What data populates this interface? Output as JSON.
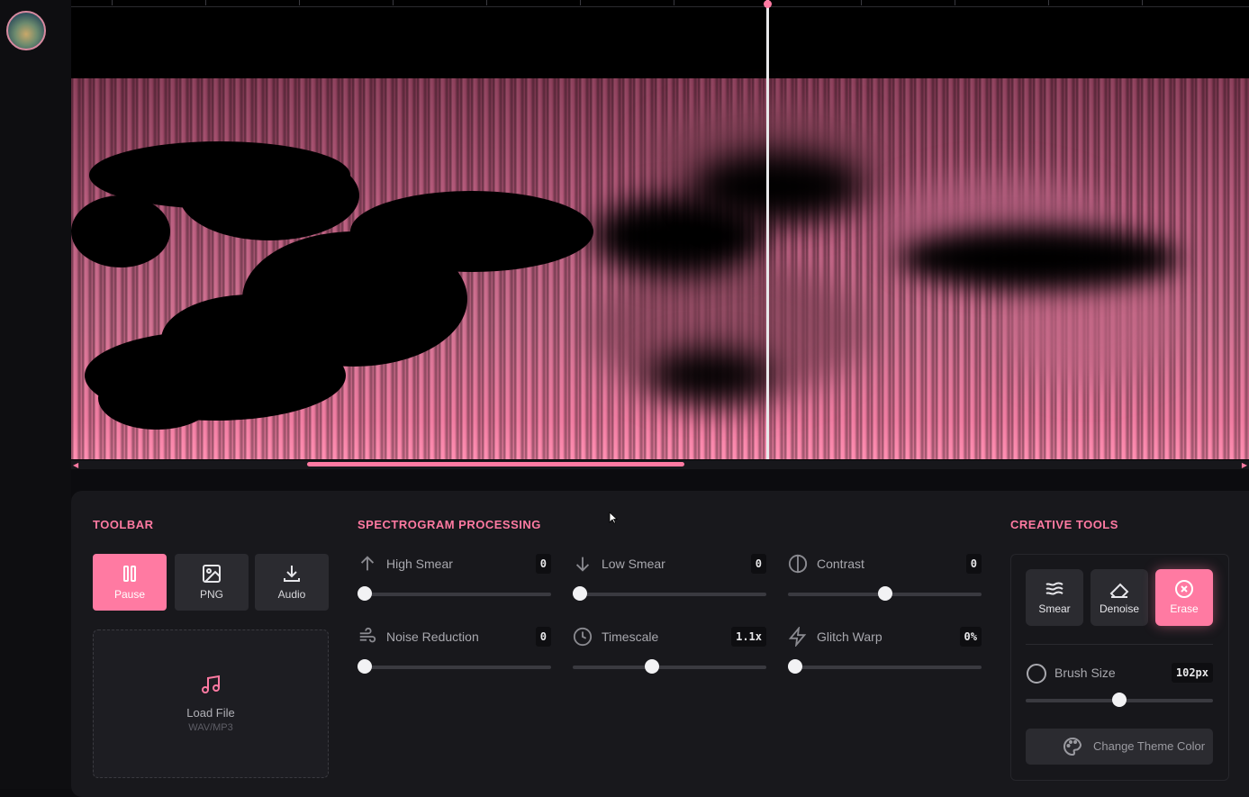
{
  "theme": {
    "accent": "#ff7aa2",
    "panel_bg": "#18181c",
    "button_bg": "#2b2b30"
  },
  "toolbar": {
    "title": "TOOLBAR",
    "pause_label": "Pause",
    "png_label": "PNG",
    "audio_label": "Audio",
    "load_file_label": "Load File",
    "load_file_hint": "WAV/MP3"
  },
  "processing": {
    "title": "SPECTROGRAM PROCESSING",
    "sliders": [
      {
        "label": "High Smear",
        "value": "0",
        "icon": "arrow-up-icon",
        "level": 0.0
      },
      {
        "label": "Low Smear",
        "value": "0",
        "icon": "arrow-down-icon",
        "level": 0.0
      },
      {
        "label": "Contrast",
        "value": "0",
        "icon": "contrast-icon",
        "level": 0.5
      },
      {
        "label": "Noise Reduction",
        "value": "0",
        "icon": "wind-icon",
        "level": 0.0
      },
      {
        "label": "Timescale",
        "value": "1.1x",
        "icon": "clock-icon",
        "level": 0.4
      },
      {
        "label": "Glitch Warp",
        "value": "0%",
        "icon": "zap-icon",
        "level": 0.0
      }
    ]
  },
  "creative": {
    "title": "CREATIVE TOOLS",
    "tools": [
      {
        "label": "Smear",
        "icon": "waves-icon",
        "active": false
      },
      {
        "label": "Denoise",
        "icon": "eraser-icon",
        "active": false
      },
      {
        "label": "Erase",
        "icon": "close-circle-icon",
        "active": true
      }
    ],
    "brush_label": "Brush Size",
    "brush_value": "102px",
    "brush_level": 0.5,
    "theme_button_label": "Change Theme Color"
  },
  "timeline": {
    "scroll_position": 0.2,
    "scroll_visible": 0.32
  }
}
